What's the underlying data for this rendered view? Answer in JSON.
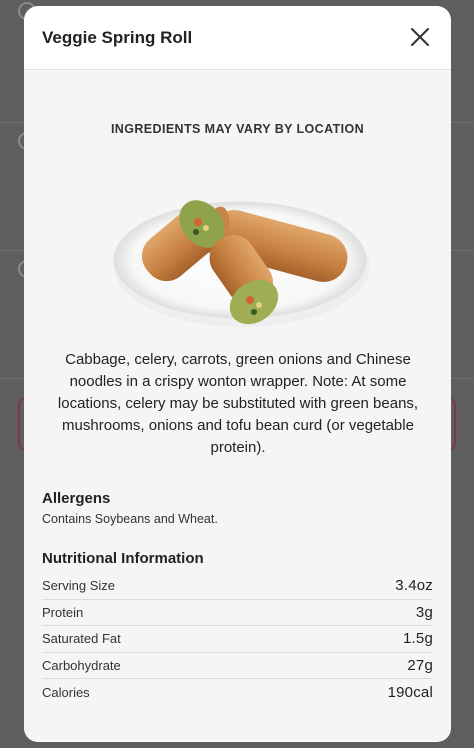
{
  "modal": {
    "title": "Veggie Spring Roll",
    "image_caption": "INGREDIENTS MAY VARY BY LOCATION",
    "description": "Cabbage, celery, carrots, green onions and Chinese noodles in a crispy wonton wrapper. Note: At some locations, celery may be substituted with green beans, mushrooms, onions and tofu bean curd (or vegetable protein).",
    "allergens_heading": "Allergens",
    "allergens_text": "Contains Soybeans and Wheat.",
    "nutrition_heading": "Nutritional Information",
    "nutrition": [
      {
        "label": "Serving Size",
        "value": "3.4oz"
      },
      {
        "label": "Protein",
        "value": "3g"
      },
      {
        "label": "Saturated Fat",
        "value": "1.5g"
      },
      {
        "label": "Carbohydrate",
        "value": "27g"
      },
      {
        "label": "Calories",
        "value": "190cal"
      }
    ]
  },
  "icons": {
    "close": "close-icon",
    "image": "spring-roll-photo"
  }
}
